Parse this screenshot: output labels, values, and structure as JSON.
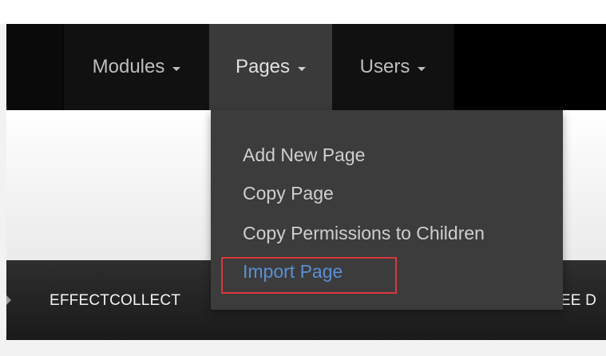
{
  "navbar": {
    "items": [
      {
        "label": "Modules"
      },
      {
        "label": "Pages"
      },
      {
        "label": "Users"
      }
    ]
  },
  "dropdown": {
    "items": [
      {
        "label": "Add New Page"
      },
      {
        "label": "Copy Page"
      },
      {
        "label": "Copy Permissions to Children"
      },
      {
        "label": "Import Page"
      }
    ],
    "highlighted_item": "Import Page",
    "highlight_color": "#d9383c",
    "active_link_color": "#5b8fd6"
  },
  "secondary_bar": {
    "left_text": "EFFECTCOLLECT",
    "right_text": "REE D"
  },
  "colors": {
    "navbar_bg": "#000000",
    "active_nav_bg": "#3a3a3a",
    "dropdown_bg": "#3c3c3c"
  }
}
